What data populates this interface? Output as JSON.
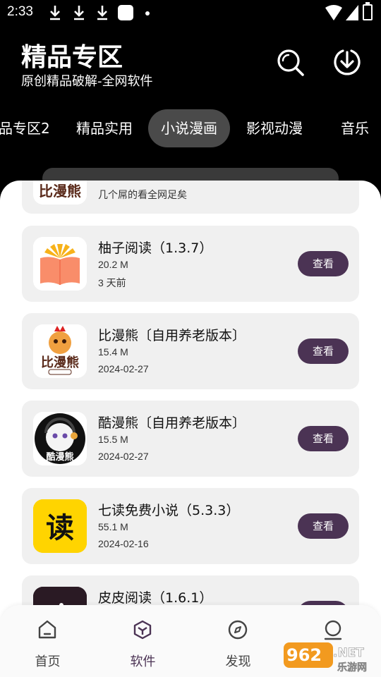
{
  "status_bar": {
    "time": "2:33"
  },
  "header": {
    "title": "精品专区",
    "subtitle": "原创精品破解-全网软件"
  },
  "tabs": [
    {
      "label": "品专区2",
      "active": false
    },
    {
      "label": "精品实用",
      "active": false
    },
    {
      "label": "小说漫画",
      "active": true
    },
    {
      "label": "影视动漫",
      "active": false
    },
    {
      "label": "音乐",
      "active": false
    }
  ],
  "apps": [
    {
      "title": "",
      "desc": "几个屌的看全网足矣",
      "thumb_text": "比漫熊"
    },
    {
      "title": "柚子阅读（1.3.7）",
      "size": "20.2 M",
      "date": "3 天前",
      "button": "查看"
    },
    {
      "title": "比漫熊〔自用养老版本〕",
      "size": "15.4 M",
      "date": "2024-02-27",
      "button": "查看",
      "thumb_text": "比漫熊"
    },
    {
      "title": "酷漫熊〔自用养老版本〕",
      "size": "15.5 M",
      "date": "2024-02-27",
      "button": "查看",
      "thumb_text": "酷漫熊"
    },
    {
      "title": "七读免费小说（5.3.3）",
      "size": "55.1 M",
      "date": "2024-02-16",
      "button": "查看",
      "thumb_text": "读"
    },
    {
      "title": "皮皮阅读（1.6.1）",
      "button": "查看"
    }
  ],
  "bottom_nav": [
    {
      "label": "首页",
      "icon": "home-icon",
      "active": false
    },
    {
      "label": "软件",
      "icon": "cube-icon",
      "active": true
    },
    {
      "label": "发现",
      "icon": "compass-icon",
      "active": false
    },
    {
      "label": "我的",
      "icon": "user-icon",
      "active": false
    }
  ],
  "watermark": {
    "text": "962.NET",
    "sub": "乐游网"
  },
  "colors": {
    "accent": "#4b3354",
    "card_bg": "#f0f0f0",
    "header_bg": "#000000"
  }
}
